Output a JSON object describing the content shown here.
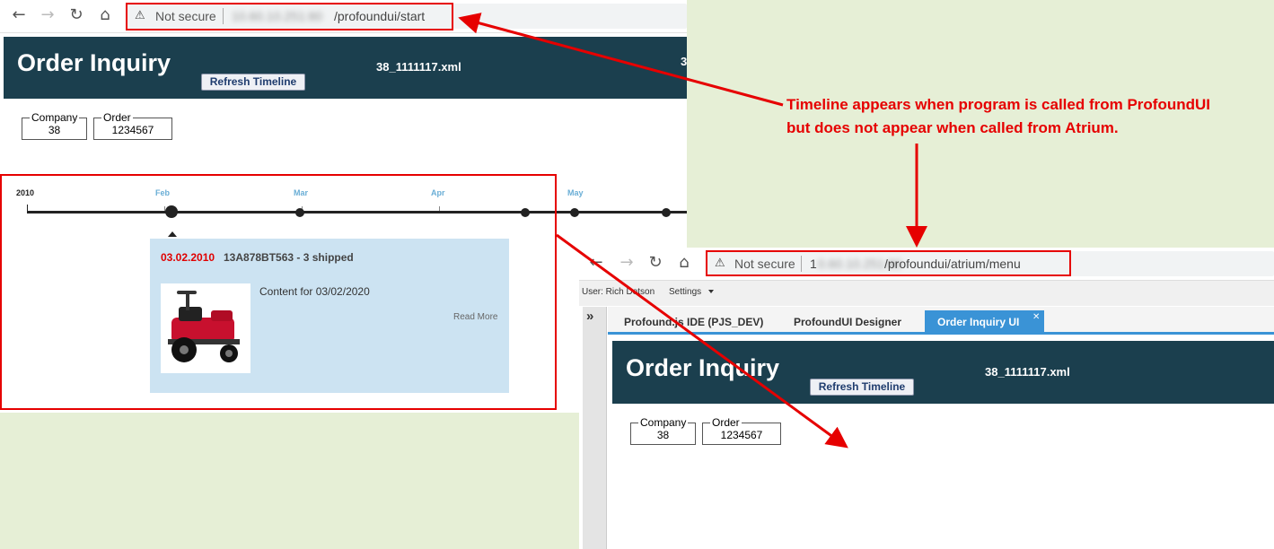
{
  "annotation": {
    "text_line1": "Timeline appears when program is called from ProfoundUI",
    "text_line2": "but does not appear when called from Atrium."
  },
  "browser1": {
    "security_label": "Not secure",
    "url_blurred": "10.60.10.251:80",
    "url_path": "/profoundui/start"
  },
  "app1": {
    "title": "Order Inquiry",
    "refresh_label": "Refresh Timeline",
    "file_name": "38_1111117.xml",
    "cut_text": "3",
    "company_label": "Company",
    "company_value": "38",
    "order_label": "Order",
    "order_value": "1234567"
  },
  "timeline": {
    "year_label": "2010",
    "months": [
      "Feb",
      "Mar",
      "Apr",
      "May"
    ],
    "event": {
      "date": "03.02.2010",
      "title": "13A878BT563 - 3 shipped",
      "content": "Content for 03/02/2020",
      "read_more": "Read More"
    }
  },
  "browser2": {
    "security_label": "Not secure",
    "url_prefix": "1",
    "url_blurred": "0.60.10.251:80",
    "url_path": "/profoundui/atrium/menu"
  },
  "atrium": {
    "user_text": "User: Rich Dotson",
    "settings_label": "Settings",
    "collapse_glyph": "»",
    "tabs": [
      {
        "label": "Profound.js IDE (PJS_DEV)"
      },
      {
        "label": "ProfoundUI Designer"
      },
      {
        "label": "Order Inquiry UI"
      }
    ],
    "close_glyph": "✕"
  },
  "app2": {
    "title": "Order Inquiry",
    "refresh_label": "Refresh Timeline",
    "file_name": "38_1111117.xml",
    "company_label": "Company",
    "company_value": "38",
    "order_label": "Order",
    "order_value": "1234567"
  },
  "colors": {
    "annotation_red": "#e60000",
    "header_bg": "#1b3f4e",
    "timeline_card": "#cce3f2",
    "atrium_tab_active": "#3a93d6",
    "bg_green": "#e6efd6"
  }
}
